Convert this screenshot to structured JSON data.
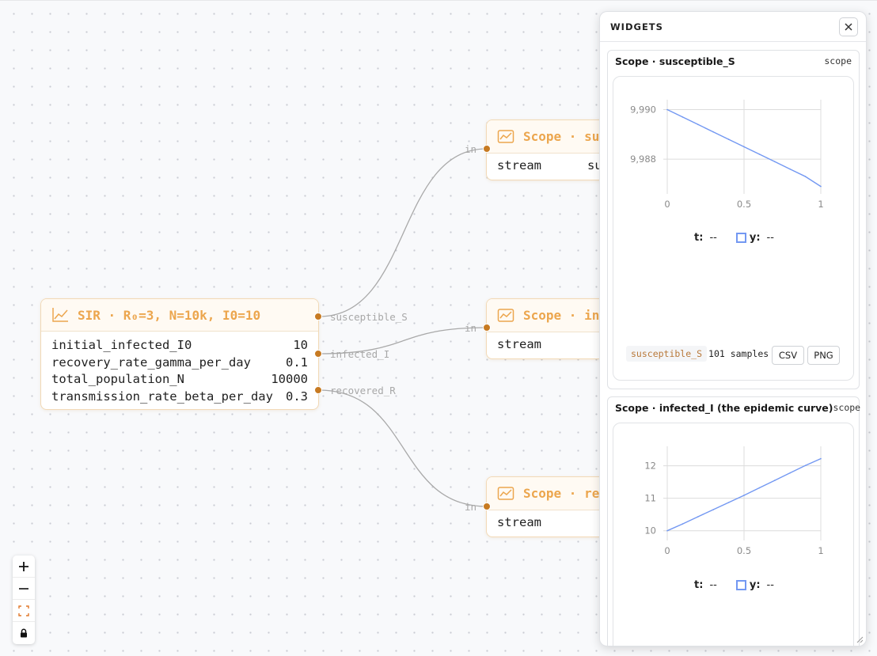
{
  "canvas": {
    "sir_node": {
      "title": "SIR · R₀=3, N=10k, I0=10",
      "params": [
        {
          "name": "initial_infected_I0",
          "value": "10"
        },
        {
          "name": "recovery_rate_gamma_per_day",
          "value": "0.1"
        },
        {
          "name": "total_population_N",
          "value": "10000"
        },
        {
          "name": "transmission_rate_beta_per_day",
          "value": "0.3"
        }
      ],
      "outputs": [
        "susceptible_S",
        "infected_I",
        "recovered_R"
      ]
    },
    "scope_nodes": [
      {
        "title": "Scope · su",
        "input_label": "in",
        "row_key": "stream",
        "row_value": "su"
      },
      {
        "title": "Scope · in",
        "input_label": "in",
        "row_key": "stream",
        "row_value": ""
      },
      {
        "title": "Scope · re",
        "input_label": "in",
        "row_key": "stream",
        "row_value": ""
      }
    ],
    "accent_color": "#eca64e",
    "port_color": "#c77a22"
  },
  "controls": {
    "zoom_in": "+",
    "zoom_out": "−",
    "icons": [
      "plus-icon",
      "minus-icon",
      "fit-view-icon",
      "lock-icon"
    ]
  },
  "panel": {
    "title": "WIDGETS",
    "close_icon": "×",
    "widgets": [
      {
        "title": "Scope · susceptible_S",
        "kind": "scope",
        "t_label": "t:",
        "t_value": "--",
        "y_label": "y:",
        "y_value": "--",
        "series_chip": "susceptible_S",
        "samples": "101 samples",
        "csv_label": "CSV",
        "png_label": "PNG"
      },
      {
        "title": "Scope · infected_I (the epidemic curve)",
        "kind": "scope",
        "t_label": "t:",
        "t_value": "--",
        "y_label": "y:",
        "y_value": "--"
      }
    ]
  },
  "chart_data": [
    {
      "type": "line",
      "series_color": "#7398f2",
      "x": [
        0,
        0.1,
        0.2,
        0.3,
        0.4,
        0.5,
        0.6,
        0.7,
        0.8,
        0.9,
        1
      ],
      "series": [
        {
          "values": [
            9990,
            9989.7,
            9989.4,
            9989.1,
            9988.8,
            9988.5,
            9988.2,
            9987.9,
            9987.6,
            9987.3,
            9986.9
          ]
        }
      ],
      "x_ticks": [
        "0",
        "0.5",
        "1"
      ],
      "y_ticks": [
        "9,990",
        "9,988"
      ],
      "xlim": [
        0,
        1
      ],
      "ylim": [
        9986.6,
        9990.4
      ],
      "grid": true
    },
    {
      "type": "line",
      "series_color": "#7398f2",
      "x": [
        0,
        0.1,
        0.2,
        0.3,
        0.4,
        0.5,
        0.6,
        0.7,
        0.8,
        0.9,
        1
      ],
      "series": [
        {
          "values": [
            10,
            10.21,
            10.43,
            10.65,
            10.87,
            11.09,
            11.32,
            11.55,
            11.78,
            12.01,
            12.22
          ]
        }
      ],
      "x_ticks": [
        "0",
        "0.5",
        "1"
      ],
      "y_ticks": [
        "12",
        "11",
        "10"
      ],
      "xlim": [
        0,
        1
      ],
      "ylim": [
        9.7,
        12.6
      ],
      "grid": true
    }
  ]
}
